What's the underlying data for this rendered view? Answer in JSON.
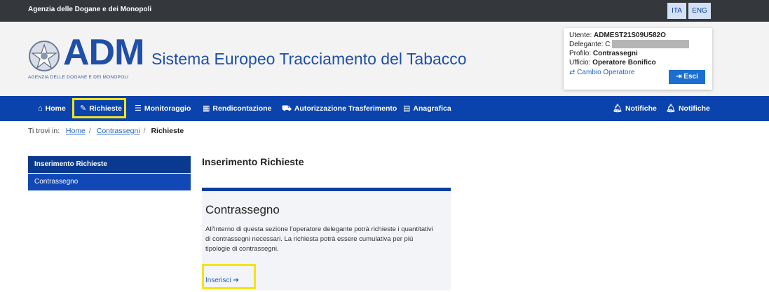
{
  "topbar": {
    "agency": "Agenzia delle Dogane e dei Monopoli",
    "lang_ita": "ITA",
    "lang_eng": "ENG"
  },
  "header": {
    "logo": "ADM",
    "logo_sub": "AGENZIA DELLE DOGANE E DEI MONOPOLI",
    "title": "Sistema Europeo Tracciamento del Tabacco"
  },
  "user": {
    "utente_label": "Utente: ",
    "utente_value": "ADMEST21S09U582O",
    "delegante_label": "Delegante: ",
    "delegante_value": "C",
    "profilo_label": "Profilo: ",
    "profilo_value": "Contrassegni",
    "ufficio_label": "Ufficio: ",
    "ufficio_value": "Operatore Bonifico",
    "cambio": "Cambio Operatore",
    "esci": "Esci"
  },
  "nav": {
    "home": "Home",
    "richieste": "Richieste",
    "monitoraggio": "Monitoraggio",
    "rendicontazione": "Rendicontazione",
    "autorizzazione": "Autorizzazione Trasferimento",
    "anagrafica": "Anagrafica",
    "notifiche1": "Notifiche",
    "notifiche2": "Notifiche"
  },
  "breadcrumb": {
    "prefix": "Ti trovi in:",
    "home": "Home",
    "contrassegni": "Contrassegni",
    "current": "Richieste"
  },
  "sidebar": {
    "items": [
      {
        "label": "Inserimento Richieste"
      },
      {
        "label": "Contrassegno"
      }
    ]
  },
  "main": {
    "title": "Inserimento Richieste",
    "card_title": "Contrassegno",
    "card_text": "All'interno di questa sezione l'operatore delegante potrà richieste i quantitativi di contrassegni necessari. La richiesta potrà essere cumulativa per più tipologie di contrassegni.",
    "card_link": "Inserisci"
  },
  "colors": {
    "nav_bg": "#0a43ad",
    "highlight": "#f4e31a",
    "brand_blue": "#1f4fa8"
  }
}
